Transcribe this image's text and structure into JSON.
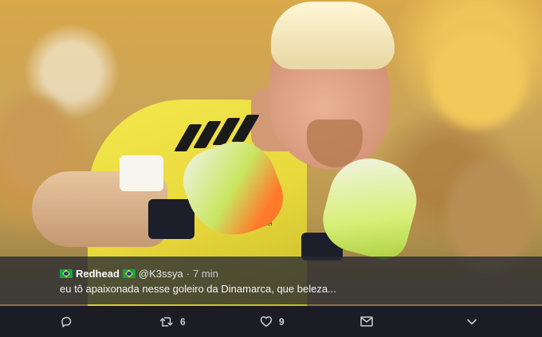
{
  "tweet": {
    "display_name": "Redhead",
    "handle": "@K3ssya",
    "separator": "·",
    "time": "7 min",
    "text": "eu tô apaixonada nesse goleiro da Dinamarca, que beleza...",
    "flag_icon": "brazil-flag-icon"
  },
  "actions": {
    "reply": {
      "icon": "reply-icon",
      "count": ""
    },
    "retweet": {
      "icon": "retweet-icon",
      "count": "6"
    },
    "like": {
      "icon": "heart-icon",
      "count": "9"
    },
    "message": {
      "icon": "mail-icon"
    },
    "more": {
      "icon": "chevron-down-icon"
    }
  },
  "image": {
    "jersey_text": "hummel",
    "colors": {
      "jersey": "#f3e84c",
      "overlay": "#282b32",
      "action_bar": "#1a1d23",
      "icon": "#c9ced8"
    }
  }
}
